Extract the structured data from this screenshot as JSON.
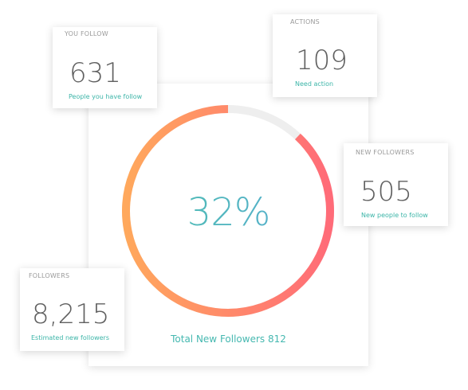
{
  "cards": {
    "you_follow": {
      "label": "YOU FOLLOW",
      "value": "631",
      "sub": "People you have follow"
    },
    "actions": {
      "label": "ACTIONS",
      "value": "109",
      "sub": "Need action"
    },
    "new_followers": {
      "label": "NEW FOLLOWERS",
      "value": "505",
      "sub": "New people to follow"
    },
    "followers": {
      "label": "FOLLOWERS",
      "value": "8,215",
      "sub": "Estimated new followers"
    }
  },
  "progress": {
    "percent_label": "32%",
    "filled_fraction": 0.88,
    "total_label": "Total New Followers 812"
  },
  "colors": {
    "ring_start": "#ff6b78",
    "ring_end": "#ffa85c",
    "ring_track": "#eeeeee",
    "accent_teal": "#3cb5a8",
    "accent_blue": "#5aa8db"
  }
}
